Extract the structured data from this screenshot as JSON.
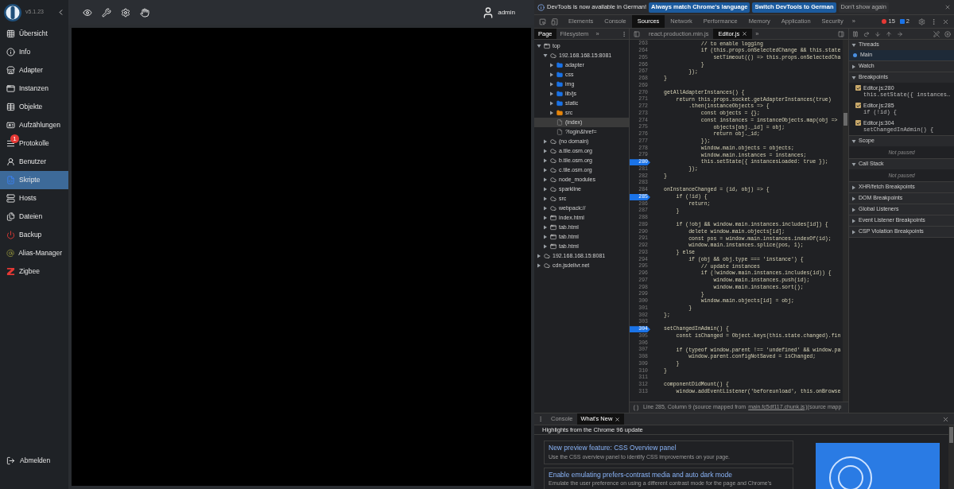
{
  "app": {
    "version": "v5.1.23",
    "user": "admin",
    "sidebar": [
      {
        "label": "Übersicht",
        "selected": false
      },
      {
        "label": "Info",
        "selected": false
      },
      {
        "label": "Adapter",
        "selected": false
      },
      {
        "label": "Instanzen",
        "selected": false
      },
      {
        "label": "Objekte",
        "selected": false
      },
      {
        "label": "Aufzählungen",
        "selected": false
      },
      {
        "label": "Protokolle",
        "selected": false,
        "badge": "1"
      },
      {
        "label": "Benutzer",
        "selected": false
      },
      {
        "label": "Skripte",
        "selected": true
      },
      {
        "label": "Hosts",
        "selected": false
      },
      {
        "label": "Dateien",
        "selected": false
      },
      {
        "label": "Backup",
        "selected": false
      },
      {
        "label": "Alias-Manager",
        "selected": false
      },
      {
        "label": "Zigbee",
        "selected": false
      }
    ],
    "logout": "Abmelden"
  },
  "devtools": {
    "infobar": {
      "message": "DevTools is now available in German!",
      "buttons": [
        "Always match Chrome's language",
        "Switch DevTools to German"
      ],
      "dismiss": "Don't show again"
    },
    "tabs": [
      {
        "label": "Elements",
        "selected": false
      },
      {
        "label": "Console",
        "selected": false
      },
      {
        "label": "Sources",
        "selected": true
      },
      {
        "label": "Network",
        "selected": false
      },
      {
        "label": "Performance",
        "selected": false
      },
      {
        "label": "Memory",
        "selected": false
      },
      {
        "label": "Application",
        "selected": false
      },
      {
        "label": "Security",
        "selected": false
      }
    ],
    "more": "»",
    "errors": "15",
    "messages": "2",
    "navigator": {
      "tabs": [
        {
          "label": "Page",
          "selected": true
        },
        {
          "label": "Filesystem",
          "selected": false
        }
      ],
      "more": "»",
      "tree": [
        {
          "label": "top",
          "kind": "frame",
          "expanded": true,
          "selected": false,
          "children": [
            {
              "label": "192.168.168.15:8081",
              "kind": "domain",
              "expanded": true,
              "selected": false,
              "children": [
                {
                  "label": "adapter",
                  "kind": "folder",
                  "color": "#1a73e8",
                  "expanded": false,
                  "selected": false
                },
                {
                  "label": "css",
                  "kind": "folder",
                  "color": "#1a73e8",
                  "expanded": false,
                  "selected": false
                },
                {
                  "label": "img",
                  "kind": "folder",
                  "color": "#1a73e8",
                  "expanded": false,
                  "selected": false
                },
                {
                  "label": "lib/js",
                  "kind": "folder",
                  "color": "#1a73e8",
                  "expanded": false,
                  "selected": false
                },
                {
                  "label": "static",
                  "kind": "folder",
                  "color": "#1a73e8",
                  "expanded": false,
                  "selected": false
                },
                {
                  "label": "src",
                  "kind": "folder",
                  "color": "#e8860a",
                  "expanded": false,
                  "selected": false
                },
                {
                  "label": "(index)",
                  "kind": "file",
                  "selected": true
                },
                {
                  "label": "?login&href=",
                  "kind": "file",
                  "selected": false
                }
              ]
            },
            {
              "label": "(no domain)",
              "kind": "domain",
              "expanded": false,
              "selected": false
            },
            {
              "label": "a.tile.osm.org",
              "kind": "domain",
              "expanded": false,
              "selected": false
            },
            {
              "label": "b.tile.osm.org",
              "kind": "domain",
              "expanded": false,
              "selected": false
            },
            {
              "label": "c.tile.osm.org",
              "kind": "domain",
              "expanded": false,
              "selected": false
            },
            {
              "label": "node_modules",
              "kind": "domain",
              "expanded": false,
              "selected": false
            },
            {
              "label": "sparkline",
              "kind": "domain",
              "expanded": false,
              "selected": false
            },
            {
              "label": "src",
              "kind": "domain",
              "expanded": false,
              "selected": false
            },
            {
              "label": "webpack://",
              "kind": "domain",
              "expanded": false,
              "selected": false
            },
            {
              "label": "index.html",
              "kind": "frame",
              "expanded": false,
              "selected": false
            },
            {
              "label": "tab.html",
              "kind": "frame",
              "expanded": false,
              "selected": false
            },
            {
              "label": "tab.html",
              "kind": "frame",
              "expanded": false,
              "selected": false
            },
            {
              "label": "tab.html",
              "kind": "frame",
              "expanded": false,
              "selected": false
            }
          ]
        },
        {
          "label": "192.168.168.15:8081",
          "kind": "domain",
          "expanded": false,
          "selected": false
        },
        {
          "label": "cdn.jsdelivr.net",
          "kind": "domain",
          "expanded": false,
          "selected": false
        }
      ]
    },
    "editor": {
      "tabs": [
        {
          "label": "react.production.min.js",
          "selected": false,
          "closable": false
        },
        {
          "label": "Editor.js",
          "selected": true,
          "closable": true
        }
      ],
      "more": "»",
      "lines": [
        {
          "n": "263",
          "code": "            // to enable logging",
          "breakpoint": false
        },
        {
          "n": "264",
          "code": "            if (this.props.onSelectedChange && this.state",
          "breakpoint": false
        },
        {
          "n": "265",
          "code": "                setTimeout(() => this.props.onSelectedCha",
          "breakpoint": false
        },
        {
          "n": "266",
          "code": "            }",
          "breakpoint": false
        },
        {
          "n": "267",
          "code": "        });",
          "breakpoint": false
        },
        {
          "n": "268",
          "code": "}",
          "breakpoint": false
        },
        {
          "n": "269",
          "breakpoint": false
        },
        {
          "n": "270",
          "code": "getAllAdapterInstances() {",
          "breakpoint": false
        },
        {
          "n": "271",
          "code": "    return this.props.socket.getAdapterInstances(true)",
          "breakpoint": false
        },
        {
          "n": "272",
          "code": "        .then(instanceObjects => {",
          "breakpoint": false
        },
        {
          "n": "273",
          "code": "            const objects = {};",
          "breakpoint": false
        },
        {
          "n": "274",
          "code": "            const instances = instanceObjects.map(obj =>",
          "breakpoint": false
        },
        {
          "n": "275",
          "code": "                objects[obj._id] = obj;",
          "breakpoint": false
        },
        {
          "n": "276",
          "code": "                return obj._id;",
          "breakpoint": false
        },
        {
          "n": "277",
          "code": "            });",
          "breakpoint": false
        },
        {
          "n": "278",
          "code": "            window.main.objects = objects;",
          "breakpoint": false
        },
        {
          "n": "279",
          "code": "            window.main.instances = instances;",
          "breakpoint": false
        },
        {
          "n": "280",
          "code": "            this.setState({ instancesLoaded: true });",
          "breakpoint": true
        },
        {
          "n": "281",
          "code": "        });",
          "breakpoint": false
        },
        {
          "n": "282",
          "code": "}",
          "breakpoint": false
        },
        {
          "n": "283",
          "breakpoint": false
        },
        {
          "n": "284",
          "code": "onInstanceChanged = (id, obj) => {",
          "breakpoint": false
        },
        {
          "n": "285",
          "code": "    if (!id) {",
          "breakpoint": true
        },
        {
          "n": "286",
          "code": "        return;",
          "breakpoint": false
        },
        {
          "n": "287",
          "code": "    }",
          "breakpoint": false
        },
        {
          "n": "288",
          "breakpoint": false
        },
        {
          "n": "289",
          "code": "    if (!obj && window.main.instances.includes[id]) {",
          "breakpoint": false
        },
        {
          "n": "290",
          "code": "        delete window.main.objects[id];",
          "breakpoint": false
        },
        {
          "n": "291",
          "code": "        const pos = window.main.instances.indexOf(id);",
          "breakpoint": false
        },
        {
          "n": "292",
          "code": "        window.main.instances.splice(pos, 1);",
          "breakpoint": false
        },
        {
          "n": "293",
          "code": "    } else",
          "breakpoint": false
        },
        {
          "n": "294",
          "code": "        if (obj && obj.type === 'instance') {",
          "breakpoint": false
        },
        {
          "n": "295",
          "code": "            // update instances",
          "breakpoint": false
        },
        {
          "n": "296",
          "code": "            if (!window.main.instances.includes(id)) {",
          "breakpoint": false
        },
        {
          "n": "297",
          "code": "                window.main.instances.push(id);",
          "breakpoint": false
        },
        {
          "n": "298",
          "code": "                window.main.instances.sort();",
          "breakpoint": false
        },
        {
          "n": "299",
          "code": "            }",
          "breakpoint": false
        },
        {
          "n": "300",
          "code": "            window.main.objects[id] = obj;",
          "breakpoint": false
        },
        {
          "n": "301",
          "code": "        }",
          "breakpoint": false
        },
        {
          "n": "302",
          "code": "};",
          "breakpoint": false
        },
        {
          "n": "303",
          "breakpoint": false
        },
        {
          "n": "304",
          "code": "setChangedInAdmin() {",
          "breakpoint": true
        },
        {
          "n": "305",
          "code": "    const isChanged = Object.keys(this.state.changed).fin",
          "breakpoint": false
        },
        {
          "n": "306",
          "breakpoint": false
        },
        {
          "n": "307",
          "code": "    if (typeof window.parent !== 'undefined' && window.pa",
          "breakpoint": false
        },
        {
          "n": "308",
          "code": "        window.parent.configNotSaved = isChanged;",
          "breakpoint": false
        },
        {
          "n": "309",
          "code": "    }",
          "breakpoint": false
        },
        {
          "n": "310",
          "code": "}",
          "breakpoint": false
        },
        {
          "n": "311",
          "breakpoint": false
        },
        {
          "n": "312",
          "code": "componentDidMount() {",
          "breakpoint": false
        },
        {
          "n": "313",
          "code": "    window.addEventListener('beforeunload', this.onBrowse",
          "breakpoint": false
        }
      ],
      "status": {
        "text": "Line 285, Column 9  (source mapped from",
        "link": "main.fc5df117.chunk.js",
        "suffix": ")(source mapp"
      }
    },
    "debugger": [
      {
        "title": "Threads",
        "expanded": true,
        "threads": [
          {
            "label": "Main",
            "selected": true
          }
        ]
      },
      {
        "title": "Watch",
        "expanded": false
      },
      {
        "title": "Breakpoints",
        "expanded": true,
        "breakpoints": [
          {
            "location": "Editor.js:280",
            "code": "this.setState({ instances…",
            "checked": true
          },
          {
            "location": "Editor.js:285",
            "code": "if (!id) {",
            "checked": true
          },
          {
            "location": "Editor.js:304",
            "code": "setChangedInAdmin() {",
            "checked": true
          }
        ]
      },
      {
        "title": "Scope",
        "expanded": true,
        "empty": "Not paused"
      },
      {
        "title": "Call Stack",
        "expanded": true,
        "empty": "Not paused"
      },
      {
        "title": "XHR/fetch Breakpoints",
        "expanded": false
      },
      {
        "title": "DOM Breakpoints",
        "expanded": false
      },
      {
        "title": "Global Listeners",
        "expanded": false
      },
      {
        "title": "Event Listener Breakpoints",
        "expanded": false
      },
      {
        "title": "CSP Violation Breakpoints",
        "expanded": false
      }
    ],
    "drawer": {
      "tabs": [
        {
          "label": "Console",
          "selected": false,
          "closable": false
        },
        {
          "label": "What's New",
          "selected": true,
          "closable": true
        }
      ],
      "heading": "Highlights from the Chrome 96 update",
      "cards": [
        {
          "title": "New preview feature: CSS Overview panel",
          "text": "Use the CSS overview panel to identify CSS improvements on your page."
        },
        {
          "title": "Enable emulating prefers-contrast media and auto dark mode",
          "text": "Emulate the user preference on using a different contrast mode for the page and Chrome's"
        }
      ]
    }
  }
}
